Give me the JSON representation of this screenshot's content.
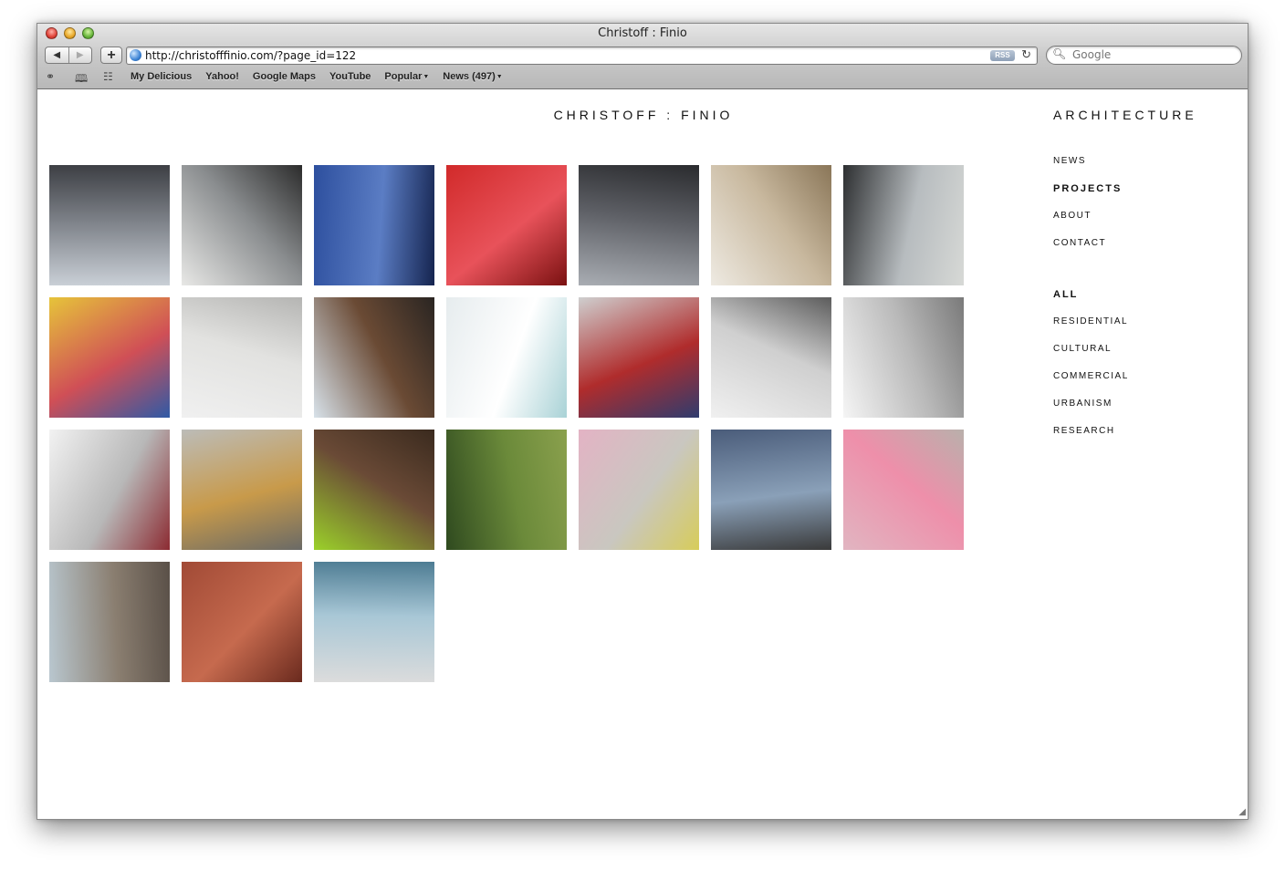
{
  "window": {
    "title": "Christoff : Finio",
    "url": "http://christofffinio.com/?page_id=122",
    "rss_label": "RSS",
    "search_placeholder": "Google"
  },
  "bookmarks": [
    {
      "label": "My Delicious"
    },
    {
      "label": "Yahoo!"
    },
    {
      "label": "Google Maps"
    },
    {
      "label": "YouTube"
    },
    {
      "label": "Popular",
      "dropdown": true
    },
    {
      "label": "News (497)",
      "dropdown": true
    }
  ],
  "site": {
    "title": "CHRISTOFF : FINIO",
    "section_heading": "ARCHITECTURE"
  },
  "nav": [
    {
      "label": "NEWS",
      "active": false
    },
    {
      "label": "PROJECTS",
      "active": true
    },
    {
      "label": "ABOUT",
      "active": false
    },
    {
      "label": "CONTACT",
      "active": false
    }
  ],
  "categories": [
    {
      "label": "ALL",
      "active": true
    },
    {
      "label": "RESIDENTIAL",
      "active": false
    },
    {
      "label": "CULTURAL",
      "active": false
    },
    {
      "label": "COMMERCIAL",
      "active": false
    },
    {
      "label": "URBANISM",
      "active": false
    },
    {
      "label": "RESEARCH",
      "active": false
    }
  ],
  "thumbnails": [
    {
      "colors": [
        "#c9cfd6",
        "#7b7f86",
        "#3d3f44"
      ]
    },
    {
      "colors": [
        "#e8e8e6",
        "#8a8d8f",
        "#2c2c2c"
      ]
    },
    {
      "colors": [
        "#2d4f9e",
        "#5b7dc4",
        "#15244f"
      ]
    },
    {
      "colors": [
        "#d12a2a",
        "#e8525a",
        "#7a1111"
      ]
    },
    {
      "colors": [
        "#a9adb3",
        "#5e6066",
        "#2a2b2e"
      ]
    },
    {
      "colors": [
        "#eeeae2",
        "#c8b89e",
        "#8a7658"
      ]
    },
    {
      "colors": [
        "#2d2f31",
        "#b7bcbf",
        "#d7d9d6"
      ]
    },
    {
      "colors": [
        "#e6c43a",
        "#d04f56",
        "#2f5aa6"
      ]
    },
    {
      "colors": [
        "#f0f0f0",
        "#e2e2e0",
        "#b5b5b3"
      ]
    },
    {
      "colors": [
        "#d8e2ea",
        "#6a4a34",
        "#2a2522"
      ]
    },
    {
      "colors": [
        "#e6ecee",
        "#ffffff",
        "#a9d2d6"
      ]
    },
    {
      "colors": [
        "#cfcfcf",
        "#b02c2c",
        "#2f3c6e"
      ]
    },
    {
      "colors": [
        "#f0f0f0",
        "#cfcfcf",
        "#5c5c5c"
      ]
    },
    {
      "colors": [
        "#f5f5f5",
        "#b9b9b9",
        "#7a7a7a"
      ]
    },
    {
      "colors": [
        "#f2f2f2",
        "#b8b8b8",
        "#8c2b32"
      ]
    },
    {
      "colors": [
        "#bcbcb8",
        "#c89a4a",
        "#6a6a66"
      ]
    },
    {
      "colors": [
        "#9bd12a",
        "#6a4a36",
        "#3a2a1e"
      ]
    },
    {
      "colors": [
        "#2f4a1f",
        "#6b8a3a",
        "#8aa04d"
      ]
    },
    {
      "colors": [
        "#e3b3c4",
        "#c9c7c0",
        "#d7cc5a"
      ]
    },
    {
      "colors": [
        "#4a5c7a",
        "#8aa0b8",
        "#3a3a3a"
      ]
    },
    {
      "colors": [
        "#e1b5c1",
        "#ee8faa",
        "#b9b0ab"
      ]
    },
    {
      "colors": [
        "#b9c7cf",
        "#8a7e70",
        "#5a5048"
      ]
    },
    {
      "colors": [
        "#a14a36",
        "#c66a4e",
        "#6a2a1e"
      ]
    },
    {
      "colors": [
        "#dcdcdc",
        "#a8c7d6",
        "#4d7c93"
      ]
    }
  ]
}
